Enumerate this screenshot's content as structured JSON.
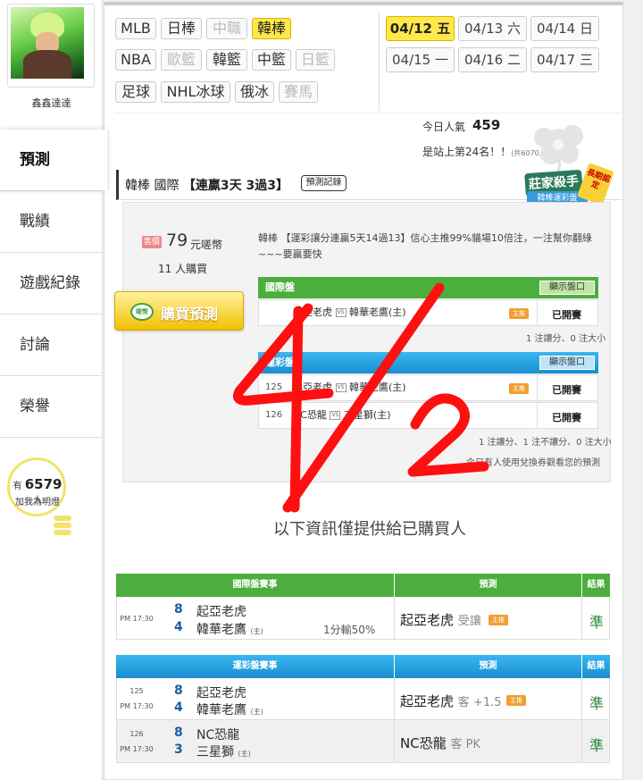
{
  "sidebar": {
    "username": "鑫鑫達達",
    "nav": [
      "預測",
      "戰績",
      "遊戲紀錄",
      "討論",
      "榮譽"
    ],
    "active": "預測",
    "fans_prefix": "有",
    "fans_count": "6579",
    "fans_suffix": "人",
    "fans_label": "加我為明燈"
  },
  "leagues": {
    "row1": [
      {
        "label": "MLB",
        "state": "normal"
      },
      {
        "label": "日棒",
        "state": "normal"
      },
      {
        "label": "中職",
        "state": "disabled"
      },
      {
        "label": "韓棒",
        "state": "active"
      }
    ],
    "row2": [
      {
        "label": "NBA",
        "state": "normal"
      },
      {
        "label": "歐籃",
        "state": "disabled"
      },
      {
        "label": "韓籃",
        "state": "normal"
      },
      {
        "label": "中籃",
        "state": "normal"
      },
      {
        "label": "日籃",
        "state": "disabled"
      }
    ],
    "row3": [
      {
        "label": "足球",
        "state": "normal"
      },
      {
        "label": "NHL冰球",
        "state": "normal"
      },
      {
        "label": "俄冰",
        "state": "normal"
      },
      {
        "label": "賽馬",
        "state": "disabled"
      }
    ]
  },
  "dates": [
    {
      "label": "04/12 五",
      "active": true
    },
    {
      "label": "04/13 六",
      "active": false
    },
    {
      "label": "04/14 日",
      "active": false
    },
    {
      "label": "04/15 一",
      "active": false
    },
    {
      "label": "04/16 二",
      "active": false
    },
    {
      "label": "04/17 三",
      "active": false
    }
  ],
  "popularity": {
    "label": "今日人氣",
    "value": "459",
    "rank": "是站上第24名！！",
    "rank_note": "(共6070人)"
  },
  "title": {
    "prefix": "韓棒 國際",
    "streak": "【連贏3天 3過3】",
    "record_button": "預測記錄",
    "badge_main": "莊家殺手",
    "badge_sub": "韓棒運彩盤",
    "badge_tag": "長期認定"
  },
  "card": {
    "price_tag": "售價",
    "price": "79",
    "price_unit": "元嗟幣",
    "buyers": "11 人購買",
    "buy_icon": "嗟幣",
    "buy_button": "購買預測",
    "description": "韓棒 【運彩讓分連贏5天14過13】信心主推99%貓場10倍注，一注幫你翻綠~~~要贏要快",
    "intl_header": "國際盤",
    "show_odds": "顯示盤口",
    "intl_games": [
      {
        "away": "起亞老虎",
        "vs": "VS",
        "home": "韓華老鷹(主)",
        "tag": "主推",
        "status": "已開賽"
      }
    ],
    "intl_note": "1 注讓分、0 注大小",
    "lottery_header": "運彩盤",
    "lottery_games": [
      {
        "num": "125",
        "away": "起亞老虎",
        "vs": "VS",
        "home": "韓華老鷹(主)",
        "tag": "主推",
        "status": "已開賽"
      },
      {
        "num": "126",
        "away": "NC恐龍",
        "vs": "VS",
        "home": "三星獅(主)",
        "tag": "",
        "status": "已開賽"
      }
    ],
    "lottery_note": "1 注讓分、1 注不讓分、0 注大小",
    "coupon_note": "今日有人使用兌換券觀看您的預測"
  },
  "info_text": "以下資訊僅提供給已購買人",
  "intl_table": {
    "headers": [
      "國際盤賽事",
      "預測",
      "結果"
    ],
    "rows": [
      {
        "time": "PM 17:30",
        "score_away": "8",
        "score_home": "4",
        "away": "起亞老虎",
        "home": "韓華老鷹",
        "home_tag": "(主)",
        "line": "1分輸50%",
        "pred_team": "起亞老虎",
        "pred_detail": "受讓",
        "pred_tag": "主推",
        "result": "準"
      }
    ]
  },
  "lottery_table": {
    "headers": [
      "運彩盤賽事",
      "預測",
      "結果"
    ],
    "rows": [
      {
        "num": "125",
        "time": "PM 17:30",
        "score_away": "8",
        "score_home": "4",
        "away": "起亞老虎",
        "home": "韓華老鷹",
        "home_tag": "(主)",
        "pred_team": "起亞老虎",
        "pred_detail": "客 +1.5",
        "pred_tag": "主推",
        "result": "準"
      },
      {
        "num": "126",
        "time": "PM 17:30",
        "score_away": "8",
        "score_home": "3",
        "away": "NC恐龍",
        "home": "三星獅",
        "home_tag": "(主)",
        "pred_team": "NC恐龍",
        "pred_detail": "客 PK",
        "pred_tag": "",
        "result": "準"
      }
    ]
  },
  "handwriting": "4/12",
  "colors": {
    "green_header": "#4cae3c",
    "blue_header": "#2aa0e0",
    "yellow_active": "#ffe84a",
    "ink_red": "#ff1010"
  }
}
